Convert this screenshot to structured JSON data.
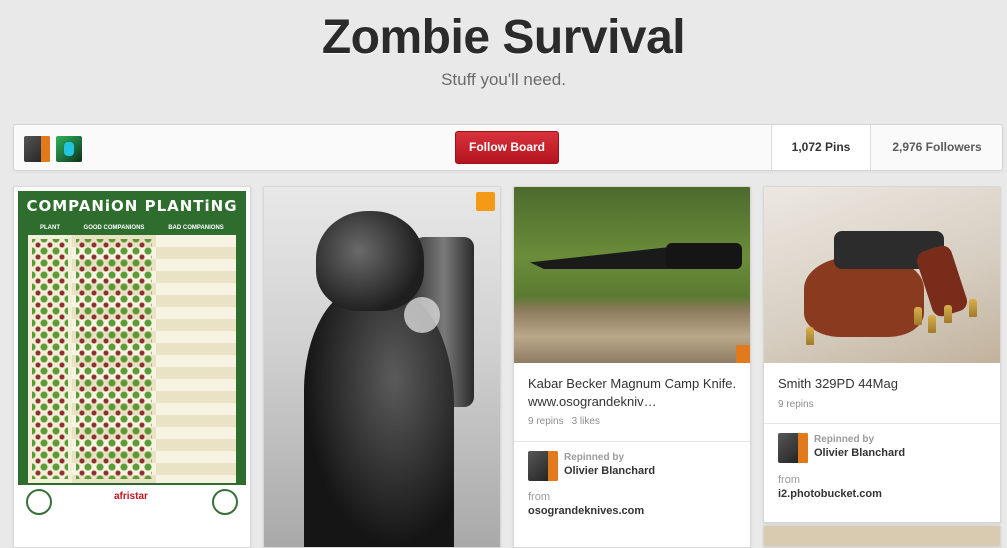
{
  "header": {
    "title": "Zombie Survival",
    "subtitle": "Stuff you'll need."
  },
  "board_bar": {
    "follow_label": "Follow Board",
    "pins": "1,072 Pins",
    "followers": "2,976 Followers"
  },
  "pins": [
    {
      "image": "companion-planting-chart",
      "image_text": {
        "title": "COMPANiON PLANTiNG",
        "col1": "PLANT",
        "col2": "GOOD COMPANIONS",
        "col3": "BAD COMPANIONS",
        "logo": "afristar"
      }
    },
    {
      "image": "hooded-gas-mask-figure-art",
      "badge_color": "#f49a17"
    },
    {
      "image": "black-knife-on-log",
      "title": "Kabar Becker Magnum Camp Knife. www.osograndekniv…",
      "repins": "9 repins",
      "likes": "3 likes",
      "repinned_label": "Repinned by",
      "repinned_by": "Olivier Blanchard",
      "from_label": "from",
      "from_source": "osograndeknives.com"
    },
    {
      "image": "revolver-in-holster-with-bullets",
      "title": "Smith 329PD 44Mag",
      "repins": "9 repins",
      "repinned_label": "Repinned by",
      "repinned_by": "Olivier Blanchard",
      "from_label": "from",
      "from_source": "i2.photobucket.com"
    }
  ],
  "colors": {
    "follow_button": "#c8202a",
    "background": "#e9e9e9",
    "accent_orange": "#e07a1c"
  }
}
